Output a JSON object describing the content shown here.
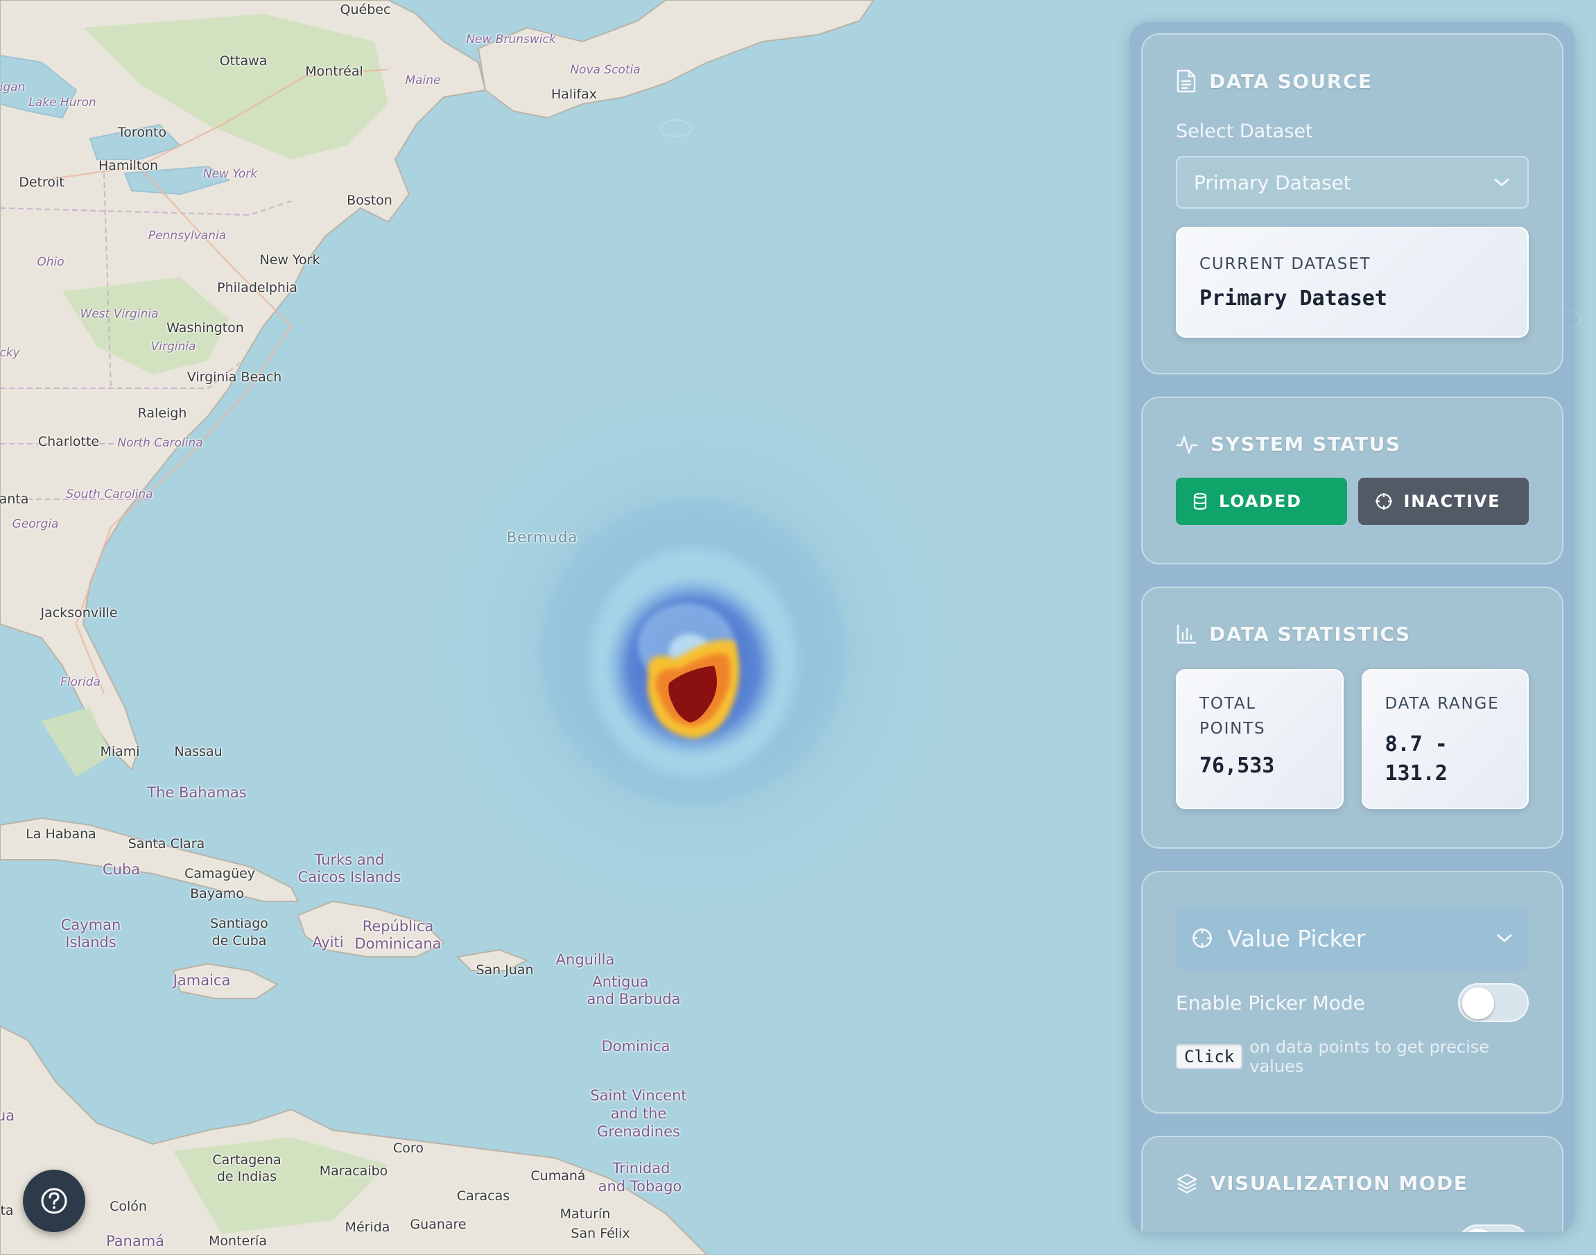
{
  "map": {
    "labels": [
      {
        "text": "Québec",
        "type": "city"
      },
      {
        "text": "Ottawa",
        "type": "city"
      },
      {
        "text": "Montréal",
        "type": "city"
      },
      {
        "text": "New Brunswick",
        "type": "region"
      },
      {
        "text": "Nova Scotia",
        "type": "region"
      },
      {
        "text": "Maine",
        "type": "region"
      },
      {
        "text": "Halifax",
        "type": "city"
      },
      {
        "text": "igan",
        "type": "region"
      },
      {
        "text": "Lake Huron",
        "type": "region"
      },
      {
        "text": "Toronto",
        "type": "city"
      },
      {
        "text": "Hamilton",
        "type": "city"
      },
      {
        "text": "Detroit",
        "type": "city"
      },
      {
        "text": "New York",
        "type": "region"
      },
      {
        "text": "Boston",
        "type": "city"
      },
      {
        "text": "Pennsylvania",
        "type": "region"
      },
      {
        "text": "Ohio",
        "type": "region"
      },
      {
        "text": "New York",
        "type": "city"
      },
      {
        "text": "Philadelphia",
        "type": "city"
      },
      {
        "text": "West Virginia",
        "type": "region"
      },
      {
        "text": "Washington",
        "type": "city"
      },
      {
        "text": "Virginia",
        "type": "region"
      },
      {
        "text": "cky",
        "type": "region"
      },
      {
        "text": "Virginia Beach",
        "type": "city"
      },
      {
        "text": "Raleigh",
        "type": "city"
      },
      {
        "text": "Charlotte",
        "type": "city"
      },
      {
        "text": "North Carolina",
        "type": "region"
      },
      {
        "text": "anta",
        "type": "city"
      },
      {
        "text": "South Carolina",
        "type": "region"
      },
      {
        "text": "Georgia",
        "type": "region"
      },
      {
        "text": "Bermuda",
        "type": "ocean"
      },
      {
        "text": "Jacksonville",
        "type": "city"
      },
      {
        "text": "Florida",
        "type": "region"
      },
      {
        "text": "Miami",
        "type": "city"
      },
      {
        "text": "Nassau",
        "type": "city"
      },
      {
        "text": "The Bahamas",
        "type": "country"
      },
      {
        "text": "La Habana",
        "type": "city"
      },
      {
        "text": "Santa Clara",
        "type": "city"
      },
      {
        "text": "Cuba",
        "type": "country"
      },
      {
        "text": "Camagüey",
        "type": "city"
      },
      {
        "text": "Bayamo",
        "type": "city"
      },
      {
        "text": "Turks and",
        "type": "country"
      },
      {
        "text": "Caicos Islands",
        "type": "country"
      },
      {
        "text": "Cayman",
        "type": "country"
      },
      {
        "text": "Islands",
        "type": "country"
      },
      {
        "text": "Santiago",
        "type": "city"
      },
      {
        "text": "de Cuba",
        "type": "city"
      },
      {
        "text": "República",
        "type": "country"
      },
      {
        "text": "Ayiti",
        "type": "country"
      },
      {
        "text": "Dominicana",
        "type": "country"
      },
      {
        "text": "Jamaica",
        "type": "country"
      },
      {
        "text": "San Juan",
        "type": "city"
      },
      {
        "text": "Anguilla",
        "type": "country"
      },
      {
        "text": "Antigua",
        "type": "country"
      },
      {
        "text": "and Barbuda",
        "type": "country"
      },
      {
        "text": "Dominica",
        "type": "country"
      },
      {
        "text": "Saint Vincent",
        "type": "country"
      },
      {
        "text": "and the",
        "type": "country"
      },
      {
        "text": "Grenadines",
        "type": "country"
      },
      {
        "text": "ua",
        "type": "country"
      },
      {
        "text": "Cartagena",
        "type": "city"
      },
      {
        "text": "de Indias",
        "type": "city"
      },
      {
        "text": "Coro",
        "type": "city"
      },
      {
        "text": "Maracaibo",
        "type": "city"
      },
      {
        "text": "Cumaná",
        "type": "city"
      },
      {
        "text": "Trinidad",
        "type": "country"
      },
      {
        "text": "and Tobago",
        "type": "country"
      },
      {
        "text": "Caracas",
        "type": "city"
      },
      {
        "text": "Colón",
        "type": "city"
      },
      {
        "text": "Maturín",
        "type": "city"
      },
      {
        "text": "ta",
        "type": "city"
      },
      {
        "text": "Mérida",
        "type": "city"
      },
      {
        "text": "Guanare",
        "type": "city"
      },
      {
        "text": "San Félix",
        "type": "city"
      },
      {
        "text": "Panamá",
        "type": "country"
      },
      {
        "text": "Montería",
        "type": "city"
      }
    ],
    "heatmap": {
      "color_low": "#4a6fc4",
      "color_mid": "#f7c030",
      "color_high": "#8b1010"
    }
  },
  "help_button": {
    "icon": "help-circle-icon"
  },
  "panel": {
    "data_source": {
      "title": "DATA SOURCE",
      "icon": "document-icon",
      "select_label": "Select Dataset",
      "selected_option": "Primary Dataset",
      "current_label": "CURRENT DATASET",
      "current_value": "Primary Dataset"
    },
    "system_status": {
      "title": "SYSTEM STATUS",
      "icon": "activity-icon",
      "loaded_label": "LOADED",
      "loaded_color": "#10a36a",
      "inactive_label": "INACTIVE",
      "inactive_color": "#525a66"
    },
    "data_statistics": {
      "title": "DATA STATISTICS",
      "icon": "bar-chart-icon",
      "total_points_label_1": "TOTAL",
      "total_points_label_2": "POINTS",
      "total_points_value": "76,533",
      "data_range_label": "DATA RANGE",
      "data_range_value_1": "8.7 -",
      "data_range_value_2": "131.2"
    },
    "value_picker": {
      "title": "Value Picker",
      "icon": "crosshair-icon",
      "toggle_label": "Enable Picker Mode",
      "toggle_on": false,
      "hint_key": "Click",
      "hint_text": "on data points to get precise values"
    },
    "visualization_mode": {
      "title": "VISUALIZATION MODE",
      "icon": "layers-icon"
    }
  }
}
